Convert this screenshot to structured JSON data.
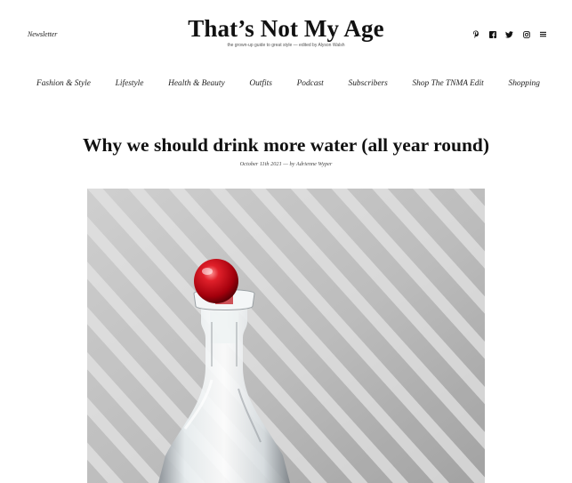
{
  "header": {
    "newsletter_label": "Newsletter",
    "site_title": "That’s Not My Age",
    "tagline": "the grown-up guide to great style — edited by Alyson Walsh",
    "social_icons": [
      {
        "name": "pinterest-icon",
        "glyph": "℘"
      },
      {
        "name": "facebook-icon",
        "glyph": "f"
      },
      {
        "name": "twitter-icon",
        "glyph": "❦"
      },
      {
        "name": "instagram-icon",
        "glyph": "◎"
      },
      {
        "name": "menu-icon",
        "glyph": "≡"
      }
    ]
  },
  "nav": {
    "items": [
      {
        "label": "Fashion & Style"
      },
      {
        "label": "Lifestyle"
      },
      {
        "label": "Health & Beauty"
      },
      {
        "label": "Outfits"
      },
      {
        "label": "Podcast"
      },
      {
        "label": "Subscribers"
      },
      {
        "label": "Shop The TNMA Edit"
      },
      {
        "label": "Shopping"
      }
    ]
  },
  "post": {
    "title": "Why we should drink more water (all year round)",
    "meta": "October 11th 2021 — by Adrienne Wyper"
  },
  "colors": {
    "background": "#ffffff",
    "text": "#111111",
    "stopper_red": "#c8101a"
  }
}
